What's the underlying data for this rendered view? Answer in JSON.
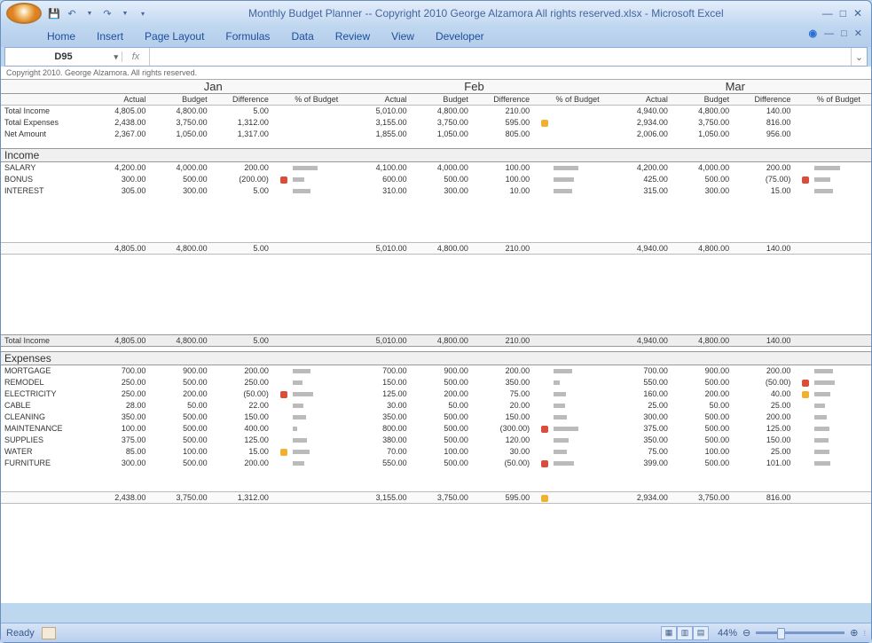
{
  "title": "Monthly Budget Planner -- Copyright 2010 George Alzamora  All rights reserved.xlsx - Microsoft Excel",
  "tabs": [
    "Home",
    "Insert",
    "Page Layout",
    "Formulas",
    "Data",
    "Review",
    "View",
    "Developer"
  ],
  "nameBox": "D95",
  "copyright": "Copyright 2010.  George Alzamora.  All rights reserved.",
  "months": [
    "Jan",
    "Feb",
    "Mar"
  ],
  "colHeaders": [
    "Actual",
    "Budget",
    "Difference",
    "% of Budget"
  ],
  "summaryRows": [
    "Total Income",
    "Total Expenses",
    "Net Amount"
  ],
  "summary": {
    "Jan": [
      [
        "4,805.00",
        "4,800.00",
        "5.00",
        ""
      ],
      [
        "2,438.00",
        "3,750.00",
        "1,312.00",
        ""
      ],
      [
        "2,367.00",
        "1,050.00",
        "1,317.00",
        ""
      ]
    ],
    "Feb": [
      [
        "5,010.00",
        "4,800.00",
        "210.00",
        ""
      ],
      [
        "3,155.00",
        "3,750.00",
        "595.00",
        "y"
      ],
      [
        "1,855.00",
        "1,050.00",
        "805.00",
        ""
      ]
    ],
    "Mar": [
      [
        "4,940.00",
        "4,800.00",
        "140.00",
        ""
      ],
      [
        "2,934.00",
        "3,750.00",
        "816.00",
        ""
      ],
      [
        "2,006.00",
        "1,050.00",
        "956.00",
        ""
      ]
    ]
  },
  "incomeHeader": "Income",
  "incomeRows": [
    "SALARY",
    "BONUS",
    "INTEREST"
  ],
  "income": {
    "Jan": [
      [
        "4,200.00",
        "4,000.00",
        "200.00",
        "",
        55
      ],
      [
        "300.00",
        "500.00",
        "(200.00)",
        "r",
        25
      ],
      [
        "305.00",
        "300.00",
        "5.00",
        "",
        40
      ]
    ],
    "Feb": [
      [
        "4,100.00",
        "4,000.00",
        "100.00",
        "",
        55
      ],
      [
        "600.00",
        "500.00",
        "100.00",
        "",
        45
      ],
      [
        "310.00",
        "300.00",
        "10.00",
        "",
        40
      ]
    ],
    "Mar": [
      [
        "4,200.00",
        "4,000.00",
        "200.00",
        "",
        55
      ],
      [
        "425.00",
        "500.00",
        "(75.00)",
        "r",
        35
      ],
      [
        "315.00",
        "300.00",
        "15.00",
        "",
        40
      ]
    ]
  },
  "incomeSubtotal": {
    "Jan": [
      "4,805.00",
      "4,800.00",
      "5.00"
    ],
    "Feb": [
      "5,010.00",
      "4,800.00",
      "210.00"
    ],
    "Mar": [
      "4,940.00",
      "4,800.00",
      "140.00"
    ]
  },
  "totalIncomeLabel": "Total Income",
  "totalIncome": {
    "Jan": [
      "4,805.00",
      "4,800.00",
      "5.00"
    ],
    "Feb": [
      "5,010.00",
      "4,800.00",
      "210.00"
    ],
    "Mar": [
      "4,940.00",
      "4,800.00",
      "140.00"
    ]
  },
  "expensesHeader": "Expenses",
  "expenseRows": [
    "MORTGAGE",
    "REMODEL",
    "ELECTRICITY",
    "CABLE",
    "CLEANING",
    "MAINTENANCE",
    "SUPPLIES",
    "WATER",
    "FURNITURE"
  ],
  "expenses": {
    "Jan": [
      [
        "700.00",
        "900.00",
        "200.00",
        "",
        40
      ],
      [
        "250.00",
        "500.00",
        "250.00",
        "",
        22
      ],
      [
        "250.00",
        "200.00",
        "(50.00)",
        "r",
        45
      ],
      [
        "28.00",
        "50.00",
        "22.00",
        "",
        24
      ],
      [
        "350.00",
        "500.00",
        "150.00",
        "",
        30
      ],
      [
        "100.00",
        "500.00",
        "400.00",
        "",
        10
      ],
      [
        "375.00",
        "500.00",
        "125.00",
        "",
        32
      ],
      [
        "85.00",
        "100.00",
        "15.00",
        "y",
        38
      ],
      [
        "300.00",
        "500.00",
        "200.00",
        "",
        26
      ]
    ],
    "Feb": [
      [
        "700.00",
        "900.00",
        "200.00",
        "",
        40
      ],
      [
        "150.00",
        "500.00",
        "350.00",
        "",
        14
      ],
      [
        "125.00",
        "200.00",
        "75.00",
        "",
        28
      ],
      [
        "30.00",
        "50.00",
        "20.00",
        "",
        26
      ],
      [
        "350.00",
        "500.00",
        "150.00",
        "",
        30
      ],
      [
        "800.00",
        "500.00",
        "(300.00)",
        "r",
        55
      ],
      [
        "380.00",
        "500.00",
        "120.00",
        "",
        33
      ],
      [
        "70.00",
        "100.00",
        "30.00",
        "",
        30
      ],
      [
        "550.00",
        "500.00",
        "(50.00)",
        "r",
        45
      ]
    ],
    "Mar": [
      [
        "700.00",
        "900.00",
        "200.00",
        "",
        40
      ],
      [
        "550.00",
        "500.00",
        "(50.00)",
        "r",
        44
      ],
      [
        "160.00",
        "200.00",
        "40.00",
        "y",
        35
      ],
      [
        "25.00",
        "50.00",
        "25.00",
        "",
        22
      ],
      [
        "300.00",
        "500.00",
        "200.00",
        "",
        26
      ],
      [
        "375.00",
        "500.00",
        "125.00",
        "",
        32
      ],
      [
        "350.00",
        "500.00",
        "150.00",
        "",
        30
      ],
      [
        "75.00",
        "100.00",
        "25.00",
        "",
        32
      ],
      [
        "399.00",
        "500.00",
        "101.00",
        "",
        35
      ]
    ]
  },
  "expenseSubtotal": {
    "Jan": [
      "2,438.00",
      "3,750.00",
      "1,312.00",
      ""
    ],
    "Feb": [
      "3,155.00",
      "3,750.00",
      "595.00",
      "y"
    ],
    "Mar": [
      "2,934.00",
      "3,750.00",
      "816.00",
      ""
    ]
  },
  "status": "Ready",
  "zoom": "44%"
}
